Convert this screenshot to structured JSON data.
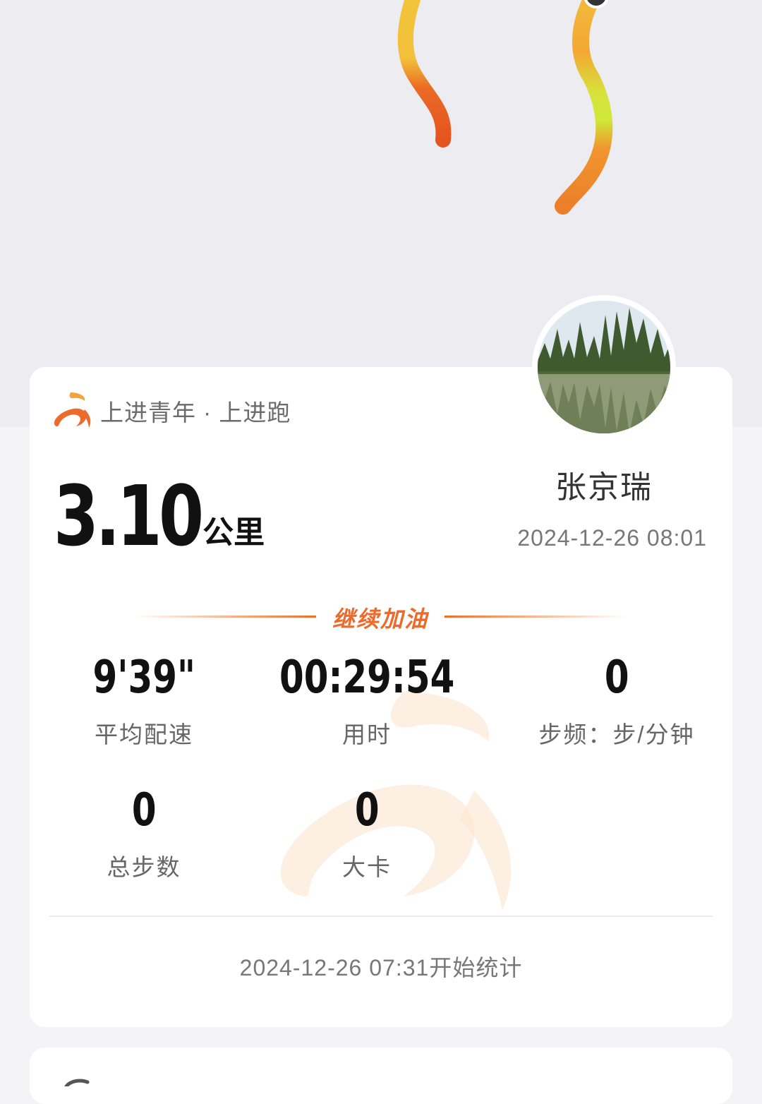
{
  "brand": {
    "name": "上进青年 · 上进跑",
    "logo_icon": "runner-logo-icon"
  },
  "user": {
    "name": "张京瑞",
    "avatar": "lake-trees-photo",
    "date": "2024-12-26 08:01"
  },
  "run": {
    "distance_value": "3.10",
    "distance_unit": "公里"
  },
  "cheer": "继续加油",
  "stats": {
    "pace": {
      "value": "9'39\"",
      "label": "平均配速"
    },
    "duration": {
      "value": "00:29:54",
      "label": "用时"
    },
    "cadence": {
      "value": "0",
      "label": "步频：步/分钟"
    },
    "steps": {
      "value": "0",
      "label": "总步数"
    },
    "calories": {
      "value": "0",
      "label": "大卡"
    }
  },
  "footer": "2024-12-26 07:31开始统计",
  "colors": {
    "accent": "#ec6a2a",
    "track_yellow": "#f2c438",
    "track_green": "#cfe83a",
    "track_orange": "#e85a20"
  }
}
